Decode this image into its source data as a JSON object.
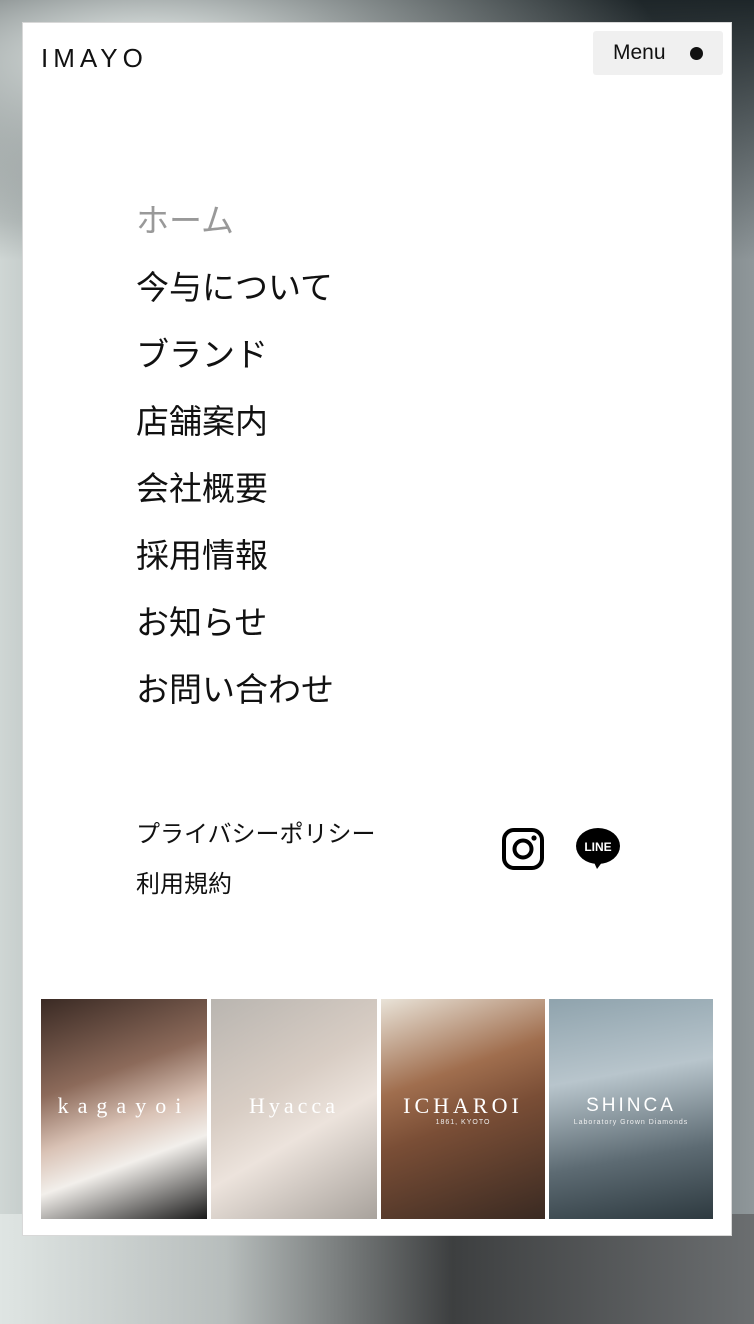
{
  "header": {
    "logo": "IMAYO",
    "menu_label": "Menu"
  },
  "nav": {
    "items": [
      {
        "label": "ホーム",
        "current": true
      },
      {
        "label": "今与について"
      },
      {
        "label": "ブランド"
      },
      {
        "label": "店舗案内"
      },
      {
        "label": "会社概要"
      },
      {
        "label": "採用情報"
      },
      {
        "label": "お知らせ"
      },
      {
        "label": "お問い合わせ"
      }
    ]
  },
  "footer_links": {
    "privacy": "プライバシーポリシー",
    "terms": "利用規約"
  },
  "social": {
    "instagram_icon": "instagram-icon",
    "line_icon": "line-icon",
    "line_text": "LINE"
  },
  "brands": [
    {
      "name": "kagayoi"
    },
    {
      "name": "Hyacca"
    },
    {
      "name": "ICHAROI",
      "sub": "1861, KYOTO"
    },
    {
      "name": "SHINCA",
      "sub": "Laboratory Grown Diamonds"
    }
  ]
}
